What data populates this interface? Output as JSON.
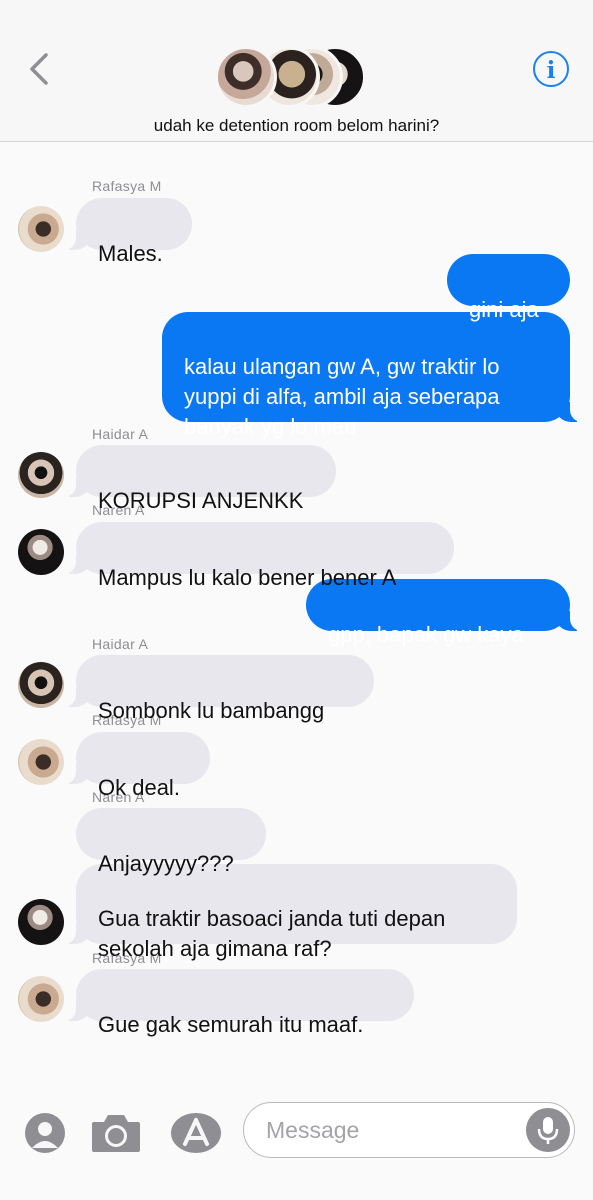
{
  "header": {
    "group_title": "udah ke detention room belom harini?",
    "back_icon": "chevron-left-icon",
    "info_icon": "info-icon",
    "info_glyph": "i"
  },
  "messages": [
    {
      "sender": "Rafasya M",
      "text": "Males.",
      "direction": "in"
    },
    {
      "sender": "",
      "text": "gini aja",
      "direction": "out"
    },
    {
      "sender": "",
      "text": "kalau ulangan gw A, gw traktir lo yuppi di alfa, ambil aja seberapa banyak yg lo mau",
      "direction": "out"
    },
    {
      "sender": "Haidar A",
      "text": "KORUPSI ANJENKK",
      "direction": "in"
    },
    {
      "sender": "Naren A",
      "text": "Mampus lu kalo bener bener A",
      "direction": "in"
    },
    {
      "sender": "",
      "text": "gpp, bapak gw kaya",
      "direction": "out"
    },
    {
      "sender": "Haidar A",
      "text": "Sombonk lu bambangg",
      "direction": "in"
    },
    {
      "sender": "Rafasya M",
      "text": "Ok deal.",
      "direction": "in"
    },
    {
      "sender": "Naren A",
      "text": "Anjayyyyy???",
      "direction": "in"
    },
    {
      "sender": "",
      "text": "Gua traktir basoaci janda tuti depan sekolah aja gimana raf?",
      "direction": "in"
    },
    {
      "sender": "Rafasya M",
      "text": "Gue gak semurah itu maaf.",
      "direction": "in"
    }
  ],
  "input": {
    "placeholder": "Message",
    "icons": [
      "memoji-icon",
      "camera-icon",
      "app-store-icon",
      "microphone-icon"
    ]
  },
  "colors": {
    "outgoing_bubble": "#0b78f3",
    "incoming_bubble": "#e8e7ed",
    "accent": "#1a82f0"
  }
}
